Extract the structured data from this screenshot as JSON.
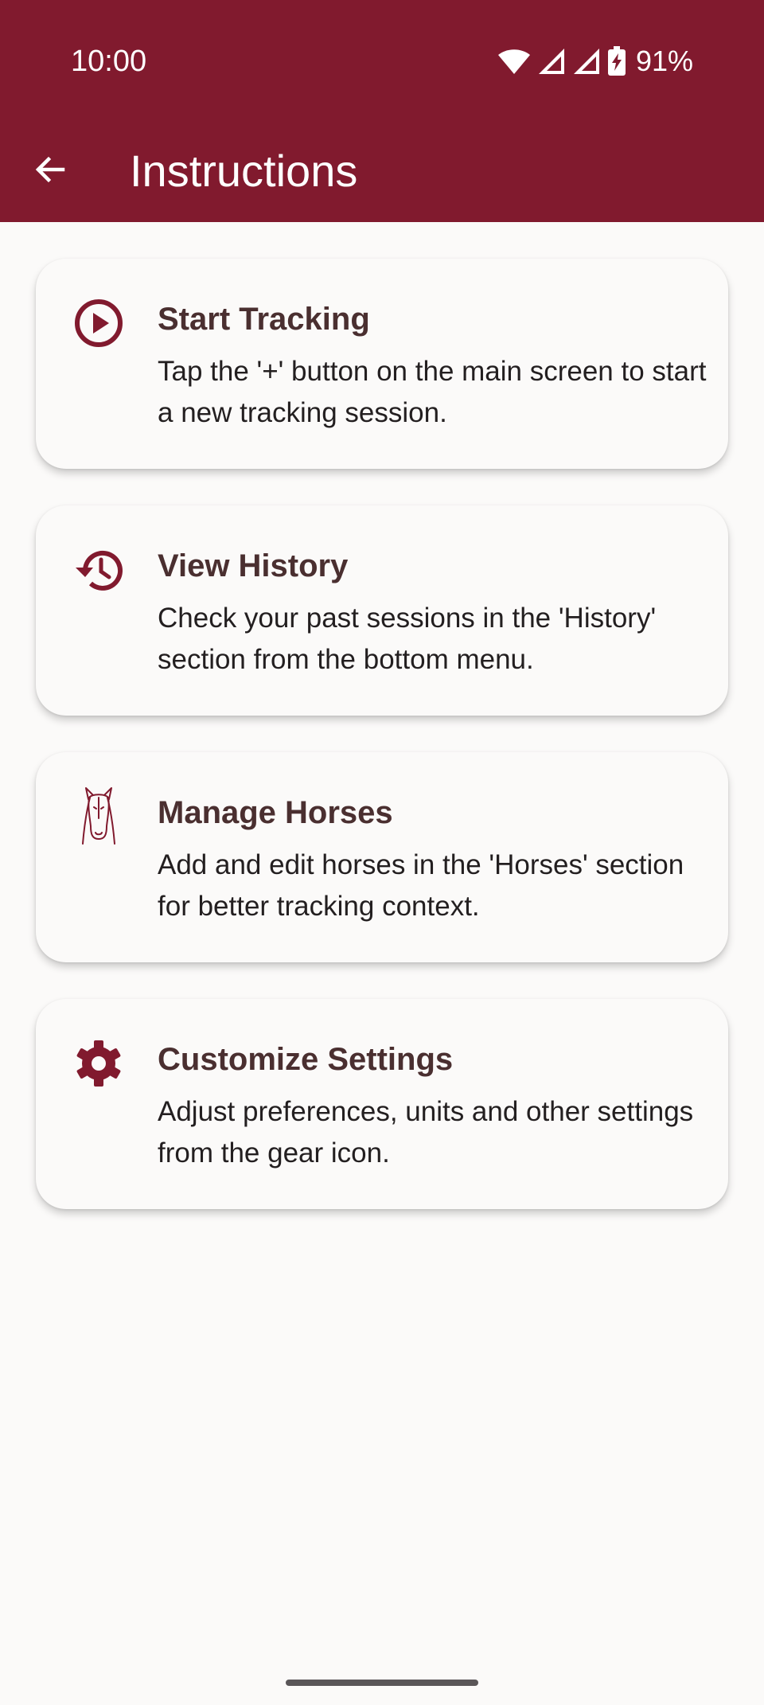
{
  "status_bar": {
    "time": "10:00",
    "battery": "91%"
  },
  "app_bar": {
    "title": "Instructions",
    "color": "#811a2e"
  },
  "accent": "#811a2e",
  "cards": [
    {
      "icon": "play-circle-icon",
      "title": "Start Tracking",
      "description": "Tap the '+' button on the main screen to start a new tracking session."
    },
    {
      "icon": "history-icon",
      "title": "View History",
      "description": "Check your past sessions in the 'History' section from the bottom menu."
    },
    {
      "icon": "horse-head-icon",
      "title": "Manage Horses",
      "description": "Add and edit horses in the 'Horses' section for better tracking context."
    },
    {
      "icon": "gear-icon",
      "title": "Customize Settings",
      "description": "Adjust preferences, units and other settings from the gear icon."
    }
  ]
}
